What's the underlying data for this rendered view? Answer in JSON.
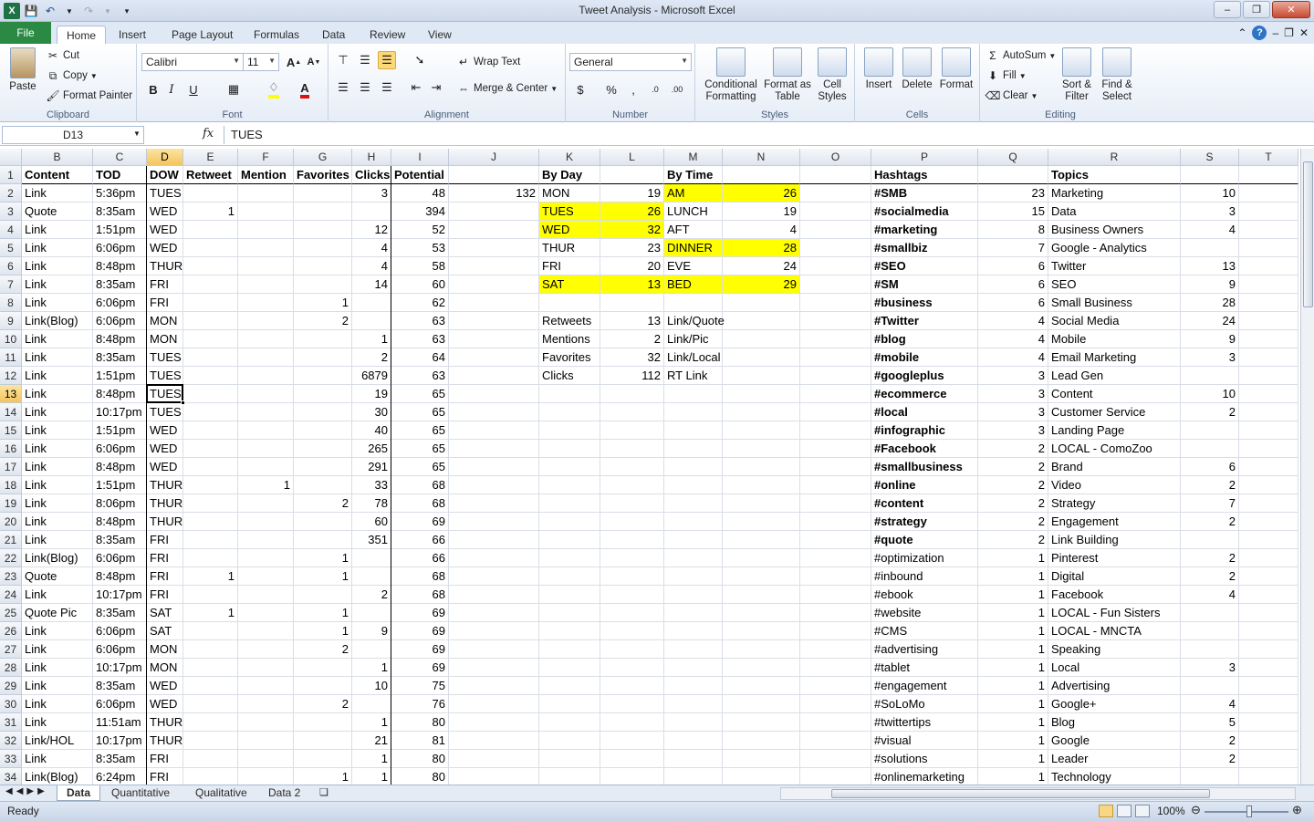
{
  "window": {
    "title": "Tweet Analysis  -  Microsoft Excel"
  },
  "tabs": [
    "File",
    "Home",
    "Insert",
    "Page Layout",
    "Formulas",
    "Data",
    "Review",
    "View"
  ],
  "ribbon": {
    "clipboard": {
      "label": "Clipboard",
      "paste": "Paste",
      "cut": "Cut",
      "copy": "Copy",
      "format_painter": "Format Painter"
    },
    "font": {
      "label": "Font",
      "name": "Calibri",
      "size": "11"
    },
    "alignment": {
      "label": "Alignment",
      "wrap_text": "Wrap Text",
      "merge_center": "Merge & Center"
    },
    "number": {
      "label": "Number",
      "format": "General"
    },
    "styles": {
      "label": "Styles",
      "conditional": "Conditional Formatting",
      "format_table": "Format as Table",
      "cell_styles": "Cell Styles"
    },
    "cells": {
      "label": "Cells",
      "insert": "Insert",
      "delete": "Delete",
      "format": "Format"
    },
    "editing": {
      "label": "Editing",
      "autosum": "AutoSum",
      "fill": "Fill",
      "clear": "Clear",
      "sort_filter": "Sort & Filter",
      "find_select": "Find & Select"
    }
  },
  "formula_bar": {
    "name_box": "D13",
    "fx": "fx",
    "value": "TUES"
  },
  "columns": [
    "B",
    "C",
    "D",
    "E",
    "F",
    "G",
    "H",
    "I",
    "J",
    "K",
    "L",
    "M",
    "N",
    "O",
    "P",
    "Q",
    "R",
    "S",
    "T"
  ],
  "rows_visible": [
    "1",
    "2",
    "3",
    "4",
    "5",
    "6",
    "7",
    "8",
    "9",
    "10",
    "11",
    "12",
    "13",
    "14",
    "15",
    "16",
    "17",
    "18",
    "19",
    "20",
    "21",
    "22",
    "23",
    "24",
    "25",
    "26",
    "27",
    "28",
    "29",
    "30",
    "31",
    "32",
    "33",
    "34"
  ],
  "selected_cell": {
    "column": "D",
    "row": "13"
  },
  "header_row": {
    "B": "Content",
    "C": "TOD",
    "D": "DOW",
    "E": "Retweet",
    "F": "Mention",
    "G": "Favorites",
    "H": "Clicks",
    "I": "Potential",
    "K": "By Day",
    "M": "By Time",
    "P": "Hashtags",
    "R": "Topics"
  },
  "main_rows": [
    [
      "Link",
      "5:36pm",
      "TUES",
      "",
      "",
      "",
      "3",
      "48"
    ],
    [
      "Quote",
      "8:35am",
      "WED",
      "1",
      "",
      "",
      "",
      "394"
    ],
    [
      "Link",
      "1:51pm",
      "WED",
      "",
      "",
      "",
      "12",
      "52"
    ],
    [
      "Link",
      "6:06pm",
      "WED",
      "",
      "",
      "",
      "4",
      "53"
    ],
    [
      "Link",
      "8:48pm",
      "THUR",
      "",
      "",
      "",
      "4",
      "58"
    ],
    [
      "Link",
      "8:35am",
      "FRI",
      "",
      "",
      "",
      "14",
      "60"
    ],
    [
      "Link",
      "6:06pm",
      "FRI",
      "",
      "",
      "1",
      "",
      "62"
    ],
    [
      "Link(Blog)",
      "6:06pm",
      "MON",
      "",
      "",
      "2",
      "",
      "63"
    ],
    [
      "Link",
      "8:48pm",
      "MON",
      "",
      "",
      "",
      "1",
      "63"
    ],
    [
      "Link",
      "8:35am",
      "TUES",
      "",
      "",
      "",
      "2",
      "64"
    ],
    [
      "Link",
      "1:51pm",
      "TUES",
      "",
      "",
      "",
      "6879",
      "63"
    ],
    [
      "Link",
      "8:48pm",
      "TUES",
      "",
      "",
      "",
      "19",
      "65"
    ],
    [
      "Link",
      "10:17pm",
      "TUES",
      "",
      "",
      "",
      "30",
      "65"
    ],
    [
      "Link",
      "1:51pm",
      "WED",
      "",
      "",
      "",
      "40",
      "65"
    ],
    [
      "Link",
      "6:06pm",
      "WED",
      "",
      "",
      "",
      "265",
      "65"
    ],
    [
      "Link",
      "8:48pm",
      "WED",
      "",
      "",
      "",
      "291",
      "65"
    ],
    [
      "Link",
      "1:51pm",
      "THUR",
      "",
      "1",
      "",
      "33",
      "68"
    ],
    [
      "Link",
      "8:06pm",
      "THUR",
      "",
      "",
      "2",
      "78",
      "68"
    ],
    [
      "Link",
      "8:48pm",
      "THUR",
      "",
      "",
      "",
      "60",
      "69"
    ],
    [
      "Link",
      "8:35am",
      "FRI",
      "",
      "",
      "",
      "351",
      "66"
    ],
    [
      "Link(Blog)",
      "6:06pm",
      "FRI",
      "",
      "",
      "1",
      "",
      "66"
    ],
    [
      "Quote",
      "8:48pm",
      "FRI",
      "1",
      "",
      "1",
      "",
      "68"
    ],
    [
      "Link",
      "10:17pm",
      "FRI",
      "",
      "",
      "",
      "2",
      "68"
    ],
    [
      "Quote Pic",
      "8:35am",
      "SAT",
      "1",
      "",
      "1",
      "",
      "69"
    ],
    [
      "Link",
      "6:06pm",
      "SAT",
      "",
      "",
      "1",
      "9",
      "69"
    ],
    [
      "Link",
      "6:06pm",
      "MON",
      "",
      "",
      "2",
      "",
      "69"
    ],
    [
      "Link",
      "10:17pm",
      "MON",
      "",
      "",
      "",
      "1",
      "69"
    ],
    [
      "Link",
      "8:35am",
      "WED",
      "",
      "",
      "",
      "10",
      "75"
    ],
    [
      "Link",
      "6:06pm",
      "WED",
      "",
      "",
      "2",
      "",
      "76"
    ],
    [
      "Link",
      "11:51am",
      "THUR",
      "",
      "",
      "",
      "1",
      "80"
    ],
    [
      "Link/HOL",
      "10:17pm",
      "THUR",
      "",
      "",
      "",
      "21",
      "81"
    ],
    [
      "Link",
      "8:35am",
      "FRI",
      "",
      "",
      "",
      "1",
      "80"
    ],
    [
      "Link(Blog)",
      "6:24pm",
      "FRI",
      "",
      "",
      "1",
      "1",
      "80"
    ]
  ],
  "j2_value": "132",
  "by_day": [
    {
      "day": "MON",
      "value": "19",
      "highlight": false
    },
    {
      "day": "TUES",
      "value": "26",
      "highlight": true
    },
    {
      "day": "WED",
      "value": "32",
      "highlight": true
    },
    {
      "day": "THUR",
      "value": "23",
      "highlight": false
    },
    {
      "day": "FRI",
      "value": "20",
      "highlight": false
    },
    {
      "day": "SAT",
      "value": "13",
      "highlight": true
    }
  ],
  "by_time": [
    {
      "time": "AM",
      "value": "26",
      "highlight": true
    },
    {
      "time": "LUNCH",
      "value": "19",
      "highlight": false
    },
    {
      "time": "AFT",
      "value": "4",
      "highlight": false
    },
    {
      "time": "DINNER",
      "value": "28",
      "highlight": true
    },
    {
      "time": "EVE",
      "value": "24",
      "highlight": false
    },
    {
      "time": "BED",
      "value": "29",
      "highlight": true
    }
  ],
  "totals": [
    {
      "label": "Retweets",
      "value": "13",
      "type": "Link/Quote"
    },
    {
      "label": "Mentions",
      "value": "2",
      "type": "Link/Pic"
    },
    {
      "label": "Favorites",
      "value": "32",
      "type": "Link/Local"
    },
    {
      "label": "Clicks",
      "value": "112",
      "type": "RT Link"
    }
  ],
  "hashtags": [
    [
      "#SMB",
      "23",
      true
    ],
    [
      "#socialmedia",
      "15",
      true
    ],
    [
      "#marketing",
      "8",
      true
    ],
    [
      "#smallbiz",
      "7",
      true
    ],
    [
      "#SEO",
      "6",
      true
    ],
    [
      "#SM",
      "6",
      true
    ],
    [
      "#business",
      "6",
      true
    ],
    [
      "#Twitter",
      "4",
      true
    ],
    [
      "#blog",
      "4",
      true
    ],
    [
      "#mobile",
      "4",
      true
    ],
    [
      "#googleplus",
      "3",
      true
    ],
    [
      "#ecommerce",
      "3",
      true
    ],
    [
      "#local",
      "3",
      true
    ],
    [
      "#infographic",
      "3",
      true
    ],
    [
      "#Facebook",
      "2",
      true
    ],
    [
      "#smallbusiness",
      "2",
      true
    ],
    [
      "#online",
      "2",
      true
    ],
    [
      "#content",
      "2",
      true
    ],
    [
      "#strategy",
      "2",
      true
    ],
    [
      "#quote",
      "2",
      true
    ],
    [
      "#optimization",
      "1",
      false
    ],
    [
      "#inbound",
      "1",
      false
    ],
    [
      "#ebook",
      "1",
      false
    ],
    [
      "#website",
      "1",
      false
    ],
    [
      "#CMS",
      "1",
      false
    ],
    [
      "#advertising",
      "1",
      false
    ],
    [
      "#tablet",
      "1",
      false
    ],
    [
      "#engagement",
      "1",
      false
    ],
    [
      "#SoLoMo",
      "1",
      false
    ],
    [
      "#twittertips",
      "1",
      false
    ],
    [
      "#visual",
      "1",
      false
    ],
    [
      "#solutions",
      "1",
      false
    ],
    [
      "#onlinemarketing",
      "1",
      false
    ]
  ],
  "topics": [
    [
      "Marketing",
      "10"
    ],
    [
      "Data",
      "3"
    ],
    [
      "Business Owners",
      "4"
    ],
    [
      "Google - Analytics",
      ""
    ],
    [
      "Twitter",
      "13"
    ],
    [
      "SEO",
      "9"
    ],
    [
      "Small Business",
      "28"
    ],
    [
      "Social Media",
      "24"
    ],
    [
      "Mobile",
      "9"
    ],
    [
      "Email Marketing",
      "3"
    ],
    [
      "Lead Gen",
      ""
    ],
    [
      "Content",
      "10"
    ],
    [
      "Customer Service",
      "2"
    ],
    [
      "Landing Page",
      ""
    ],
    [
      "LOCAL - ComoZoo",
      ""
    ],
    [
      "Brand",
      "6"
    ],
    [
      "Video",
      "2"
    ],
    [
      "Strategy",
      "7"
    ],
    [
      "Engagement",
      "2"
    ],
    [
      "Link Building",
      ""
    ],
    [
      "Pinterest",
      "2"
    ],
    [
      "Digital",
      "2"
    ],
    [
      "Facebook",
      "4"
    ],
    [
      "LOCAL - Fun Sisters",
      ""
    ],
    [
      "LOCAL - MNCTA",
      ""
    ],
    [
      "Speaking",
      ""
    ],
    [
      "Local",
      "3"
    ],
    [
      "Advertising",
      ""
    ],
    [
      "Google+",
      "4"
    ],
    [
      "Blog",
      "5"
    ],
    [
      "Google",
      "2"
    ],
    [
      "Leader",
      "2"
    ],
    [
      "Technology",
      ""
    ]
  ],
  "sheets": [
    "Data",
    "Quantitative",
    "Qualitative",
    "Data 2"
  ],
  "active_sheet": "Data",
  "status": {
    "text": "Ready",
    "zoom": "100%"
  },
  "colors": {
    "highlight": "#ffff00",
    "file_tab": "#2a8a43",
    "selected_header": "#f4c45d"
  }
}
